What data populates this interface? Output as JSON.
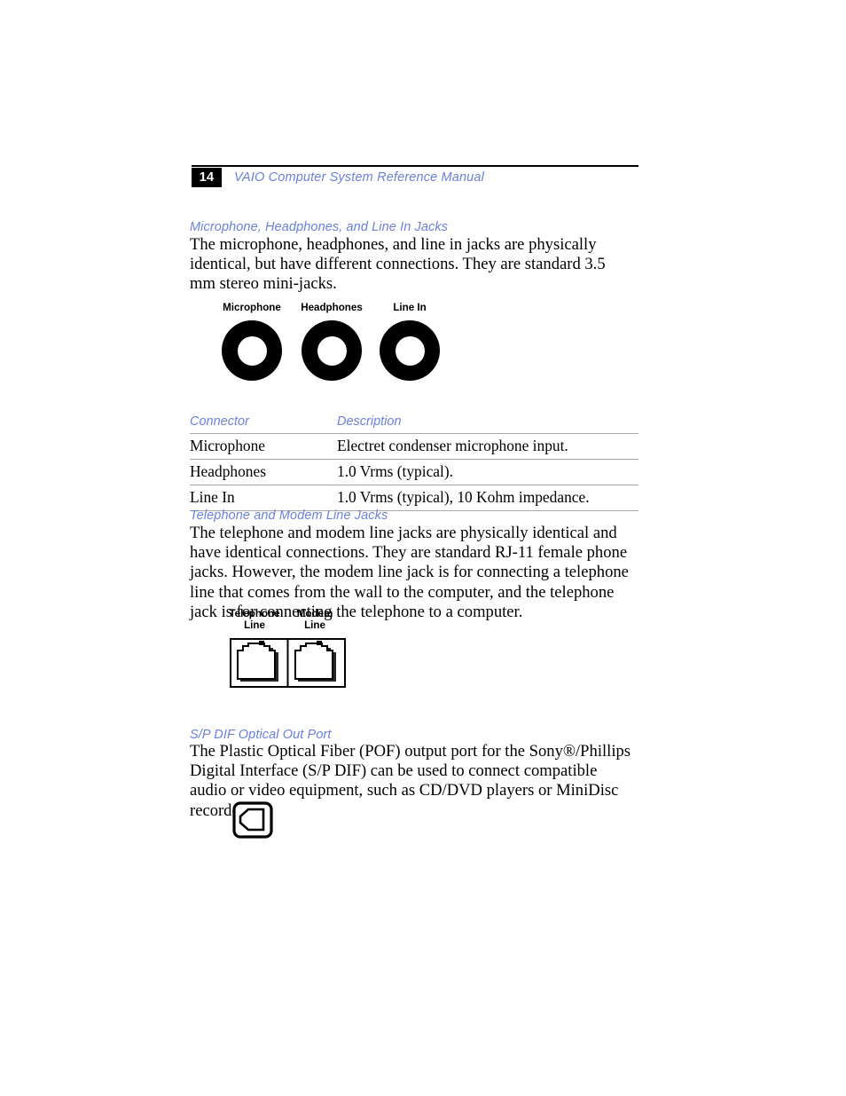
{
  "document": {
    "page_number": "14",
    "running_title": "VAIO Computer System Reference Manual",
    "accent_color": "#6a81dd",
    "rule_color": "#a9a9a9"
  },
  "sections": [
    {
      "heading": "Microphone, Headphones, and Line In Jacks",
      "body": "The microphone, headphones, and line in jacks are physically identical, but have different connections. They are standard 3.5 mm stereo mini-jacks."
    },
    {
      "heading": "Telephone and Modem Line Jacks",
      "body": "The telephone and modem line jacks are physically identical and have identical connections. They are standard RJ-11 female phone jacks. However, the modem line jack is for connecting a telephone line that comes from the wall to the computer, and the telephone jack is for connecting the telephone to a computer."
    },
    {
      "heading": "S/P DIF Optical Out Port",
      "body": "The Plastic Optical Fiber (POF) output port for the Sony®/Phillips Digital Interface (S/P DIF) can be used to connect compatible audio or video equipment, such as CD/DVD players or MiniDisc recorders."
    }
  ],
  "audio_jack_figure": {
    "jacks": [
      {
        "label": "Microphone",
        "icon": "audio-jack-icon"
      },
      {
        "label": "Headphones",
        "icon": "audio-jack-icon"
      },
      {
        "label": "Line In",
        "icon": "audio-jack-icon"
      }
    ]
  },
  "spec_table": {
    "columns": [
      "Connector",
      "Description"
    ],
    "rows": [
      [
        "Microphone",
        "Electret condenser microphone input."
      ],
      [
        "Headphones",
        "1.0 Vrms (typical)."
      ],
      [
        "Line In",
        "1.0 Vrms (typical), 10 Kohm impedance."
      ]
    ]
  },
  "rj11_figure": {
    "jacks": [
      {
        "label_line1": "Telephone",
        "label_line2": "Line",
        "icon": "rj11-jack-icon"
      },
      {
        "label_line1": "Modem",
        "label_line2": "Line",
        "icon": "rj11-jack-icon"
      }
    ]
  },
  "spdif_figure": {
    "icon": "spdif-optical-port-icon"
  }
}
